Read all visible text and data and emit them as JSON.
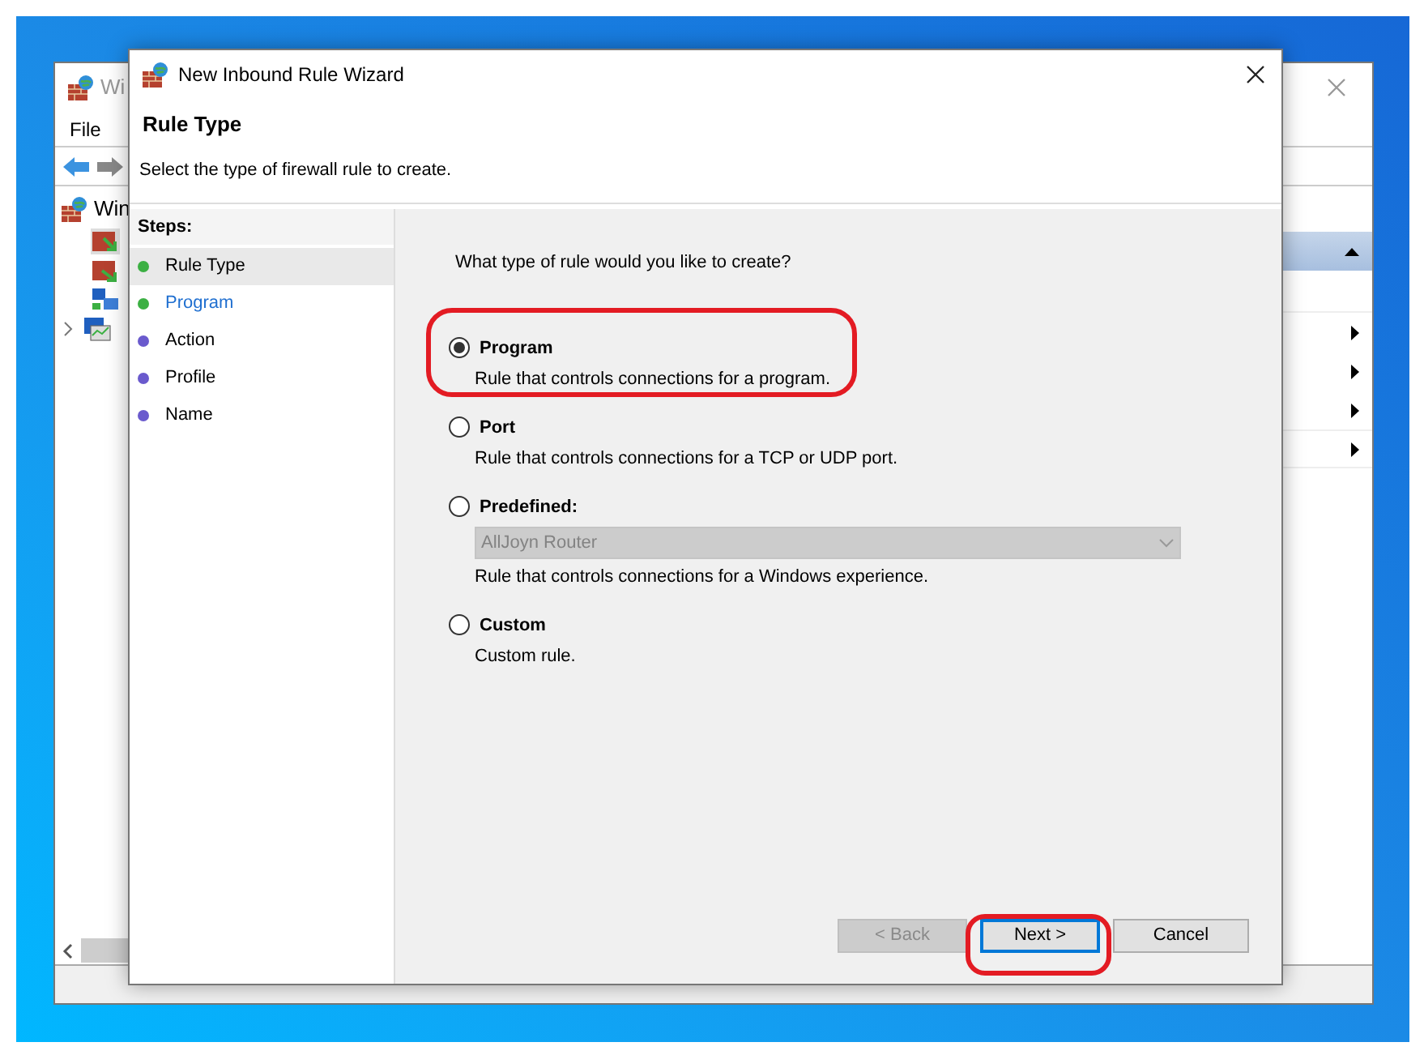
{
  "background_window": {
    "title": "Wi",
    "menu": [
      "File"
    ],
    "tree_root": "Win"
  },
  "dialog": {
    "title": "New Inbound Rule Wizard",
    "heading": "Rule Type",
    "subtitle": "Select the type of firewall rule to create.",
    "steps_title": "Steps:",
    "steps": [
      {
        "label": "Rule Type",
        "selected": true,
        "current": false,
        "color": "#3cb043"
      },
      {
        "label": "Program",
        "selected": false,
        "current": true,
        "color": "#3cb043"
      },
      {
        "label": "Action",
        "selected": false,
        "current": false,
        "color": "#6a5acd"
      },
      {
        "label": "Profile",
        "selected": false,
        "current": false,
        "color": "#6a5acd"
      },
      {
        "label": "Name",
        "selected": false,
        "current": false,
        "color": "#6a5acd"
      }
    ],
    "question": "What type of rule would you like to create?",
    "options": [
      {
        "label": "Program",
        "description": "Rule that controls connections for a program.",
        "selected": true
      },
      {
        "label": "Port",
        "description": "Rule that controls connections for a TCP or UDP port.",
        "selected": false
      },
      {
        "label": "Predefined:",
        "dropdown": {
          "value": "AllJoyn Router",
          "disabled": true
        },
        "description": "Rule that controls connections for a Windows experience.",
        "selected": false
      },
      {
        "label": "Custom",
        "description": "Custom rule.",
        "selected": false
      }
    ],
    "buttons": [
      {
        "label": "< Back",
        "disabled": true,
        "focused": false
      },
      {
        "label": "Next >",
        "disabled": false,
        "focused": true
      },
      {
        "label": "Cancel",
        "disabled": false,
        "focused": false
      }
    ]
  }
}
